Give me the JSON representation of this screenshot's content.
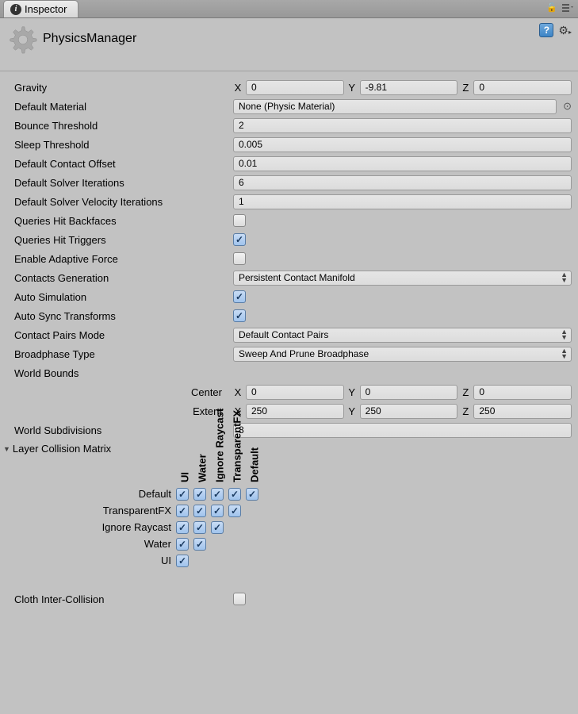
{
  "tab": {
    "label": "Inspector"
  },
  "header": {
    "title": "PhysicsManager"
  },
  "gravity": {
    "label": "Gravity",
    "x": "0",
    "y": "-9.81",
    "z": "0"
  },
  "defaultMaterial": {
    "label": "Default Material",
    "value": "None (Physic Material)"
  },
  "bounceThreshold": {
    "label": "Bounce Threshold",
    "value": "2"
  },
  "sleepThreshold": {
    "label": "Sleep Threshold",
    "value": "0.005"
  },
  "defaultContactOffset": {
    "label": "Default Contact Offset",
    "value": "0.01"
  },
  "defaultSolverIterations": {
    "label": "Default Solver Iterations",
    "value": "6"
  },
  "defaultSolverVelocityIterations": {
    "label": "Default Solver Velocity Iterations",
    "value": "1"
  },
  "queriesHitBackfaces": {
    "label": "Queries Hit Backfaces",
    "value": false
  },
  "queriesHitTriggers": {
    "label": "Queries Hit Triggers",
    "value": true
  },
  "enableAdaptiveForce": {
    "label": "Enable Adaptive Force",
    "value": false
  },
  "contactsGeneration": {
    "label": "Contacts Generation",
    "value": "Persistent Contact Manifold"
  },
  "autoSimulation": {
    "label": "Auto Simulation",
    "value": true
  },
  "autoSyncTransforms": {
    "label": "Auto Sync Transforms",
    "value": true
  },
  "contactPairsMode": {
    "label": "Contact Pairs Mode",
    "value": "Default Contact Pairs"
  },
  "broadphaseType": {
    "label": "Broadphase Type",
    "value": "Sweep And Prune Broadphase"
  },
  "worldBounds": {
    "label": "World Bounds",
    "center": {
      "label": "Center",
      "x": "0",
      "y": "0",
      "z": "0"
    },
    "extent": {
      "label": "Extent",
      "x": "250",
      "y": "250",
      "z": "250"
    }
  },
  "worldSubdivisions": {
    "label": "World Subdivisions",
    "value": "8"
  },
  "layerCollisionMatrix": {
    "label": "Layer Collision Matrix",
    "layers": [
      "Default",
      "TransparentFX",
      "Ignore Raycast",
      "Water",
      "UI"
    ],
    "cells": [
      [
        true,
        true,
        true,
        true,
        true
      ],
      [
        true,
        true,
        true,
        true
      ],
      [
        true,
        true,
        true
      ],
      [
        true,
        true
      ],
      [
        true
      ]
    ]
  },
  "clothInterCollision": {
    "label": "Cloth Inter-Collision",
    "value": false
  },
  "axis": {
    "x": "X",
    "y": "Y",
    "z": "Z"
  }
}
